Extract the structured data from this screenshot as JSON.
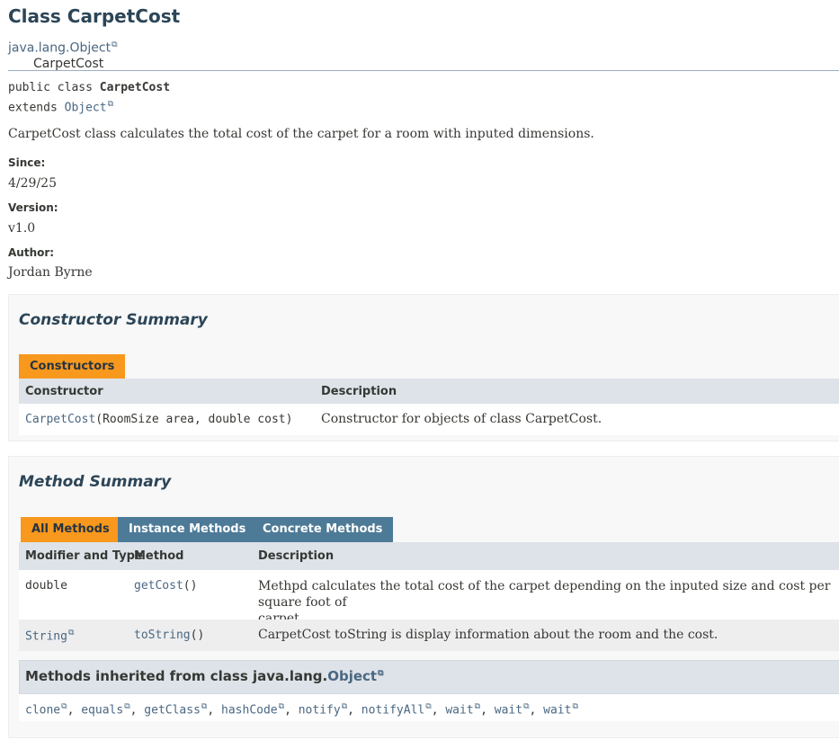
{
  "class_title": "Class CarpetCost",
  "inheritance": {
    "parent": "java.lang.Object",
    "child": "CarpetCost"
  },
  "signature": {
    "line1_prefix": "public class ",
    "class_name": "CarpetCost",
    "extends_kw": "extends ",
    "superclass": "Object"
  },
  "description": "CarpetCost class calculates the total cost of the carpet for a room with inputed dimensions.",
  "tags": {
    "since_label": "Since:",
    "since_value": "4/29/25",
    "version_label": "Version:",
    "version_value": "v1.0",
    "author_label": "Author:",
    "author_value": "Jordan Byrne"
  },
  "constructor_summary": {
    "title": "Constructor Summary",
    "tab": "Constructors",
    "headers": [
      "Constructor",
      "Description"
    ],
    "rows": [
      {
        "name": "CarpetCost",
        "params": "(RoomSize area, double cost)",
        "description": "Constructor for objects of class CarpetCost."
      }
    ]
  },
  "method_summary": {
    "title": "Method Summary",
    "tabs": [
      "All Methods",
      "Instance Methods",
      "Concrete Methods"
    ],
    "active_tab": "All Methods",
    "headers": [
      "Modifier and Type",
      "Method",
      "Description"
    ],
    "rows": [
      {
        "type": "double",
        "method": "getCost",
        "params": "()",
        "description_line1": "Methpd calculates the total cost of the carpet depending on the inputed size and cost per square foot of",
        "description_line2": "carpet."
      },
      {
        "type": "String",
        "method": "toString",
        "params": "()",
        "description": "CarpetCost toString is display information about the room and the cost."
      }
    ],
    "inherited": {
      "title_prefix": "Methods inherited from class java.lang.",
      "title_link": "Object",
      "methods": [
        "clone",
        "equals",
        "getClass",
        "hashCode",
        "notify",
        "notifyAll",
        "wait",
        "wait",
        "wait"
      ]
    }
  },
  "colors": {
    "tab_active": "#f8981d",
    "tab_inactive": "#4d7a97",
    "header_bg": "#dee3e9",
    "link": "#4a6782",
    "title": "#2c4557"
  },
  "icons": {
    "external_link": "external-link-icon"
  }
}
